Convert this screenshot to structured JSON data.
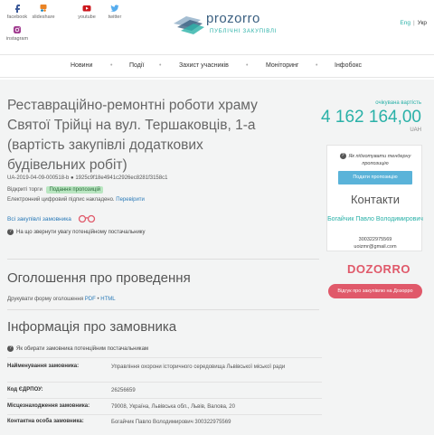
{
  "social": [
    {
      "label": "facebook",
      "icon": "facebook-icon",
      "color": "#3b5998"
    },
    {
      "label": "slideshare",
      "icon": "slideshare-icon",
      "color": "#e98325"
    },
    {
      "label": "youtube",
      "icon": "youtube-icon",
      "color": "#cc181e"
    },
    {
      "label": "twitter",
      "icon": "twitter-icon",
      "color": "#55acee"
    },
    {
      "label": "instagram",
      "icon": "instagram-icon",
      "color": "#a03b8f"
    }
  ],
  "logo": {
    "name": "prozorro",
    "subtitle": "ПУБЛІЧНІ ЗАКУПІВЛІ"
  },
  "lang": {
    "en": "Eng",
    "uk": "Укр"
  },
  "nav": [
    "Новини",
    "Події",
    "Захист учасників",
    "Моніторинг",
    "Інфобокс"
  ],
  "tender": {
    "title": "Реставраційно-ремонтні роботи храму Святої Трійці на вул. Тершаковців, 1-а (вартість закупівлі додаткових будівельних робіт)",
    "budget_label": "очікувана вартість",
    "budget": "4 162 164,00",
    "currency": "UAH",
    "id": "UA-2019-04-09-000518-b ● 1925c9f18e4941c2926ec8281f3158c1",
    "type": "Відкриті торги",
    "status": "Подання пропозицій",
    "signature": "Електронний цифровий підпис накладено.",
    "verify": "Перевірити",
    "all_link": "Всі закупівлі замовника",
    "attention": "На що звернути увагу потенційному постачальнику"
  },
  "panel": {
    "question": "Як підготувати тендерну пропозицію",
    "button": "Подати пропозицію",
    "heading": "Контакти",
    "name": "Богайчик Павло Володимирович",
    "phone": "300322975569",
    "email": "uoizmr@gmail.com"
  },
  "dozorro": {
    "logo": "DOZORRO",
    "button": "Відгук про закупівлю на Дозорро"
  },
  "announcement": {
    "heading": "Оголошення про проведення",
    "print_prefix": "Друкувати форму оголошення",
    "pdf": "PDF",
    "html": "HTML"
  },
  "customer": {
    "heading": "Інформація про замовника",
    "note": "Як обирати замовника потенційним постачальникам",
    "rows": [
      {
        "k": "Найменування замовника:",
        "v": "Управління охорони історичного середовища Львівської міської ради"
      },
      {
        "k": "Код ЄДРПОУ:",
        "v": "26256659"
      },
      {
        "k": "Місцезнаходження замовника:",
        "v": "79008, Україна, Львівська обл., Львів, Валова, 20"
      },
      {
        "k": "Контактна особа замовника:",
        "v": "Богайчик Павло Володимирович 300322975569"
      }
    ]
  }
}
